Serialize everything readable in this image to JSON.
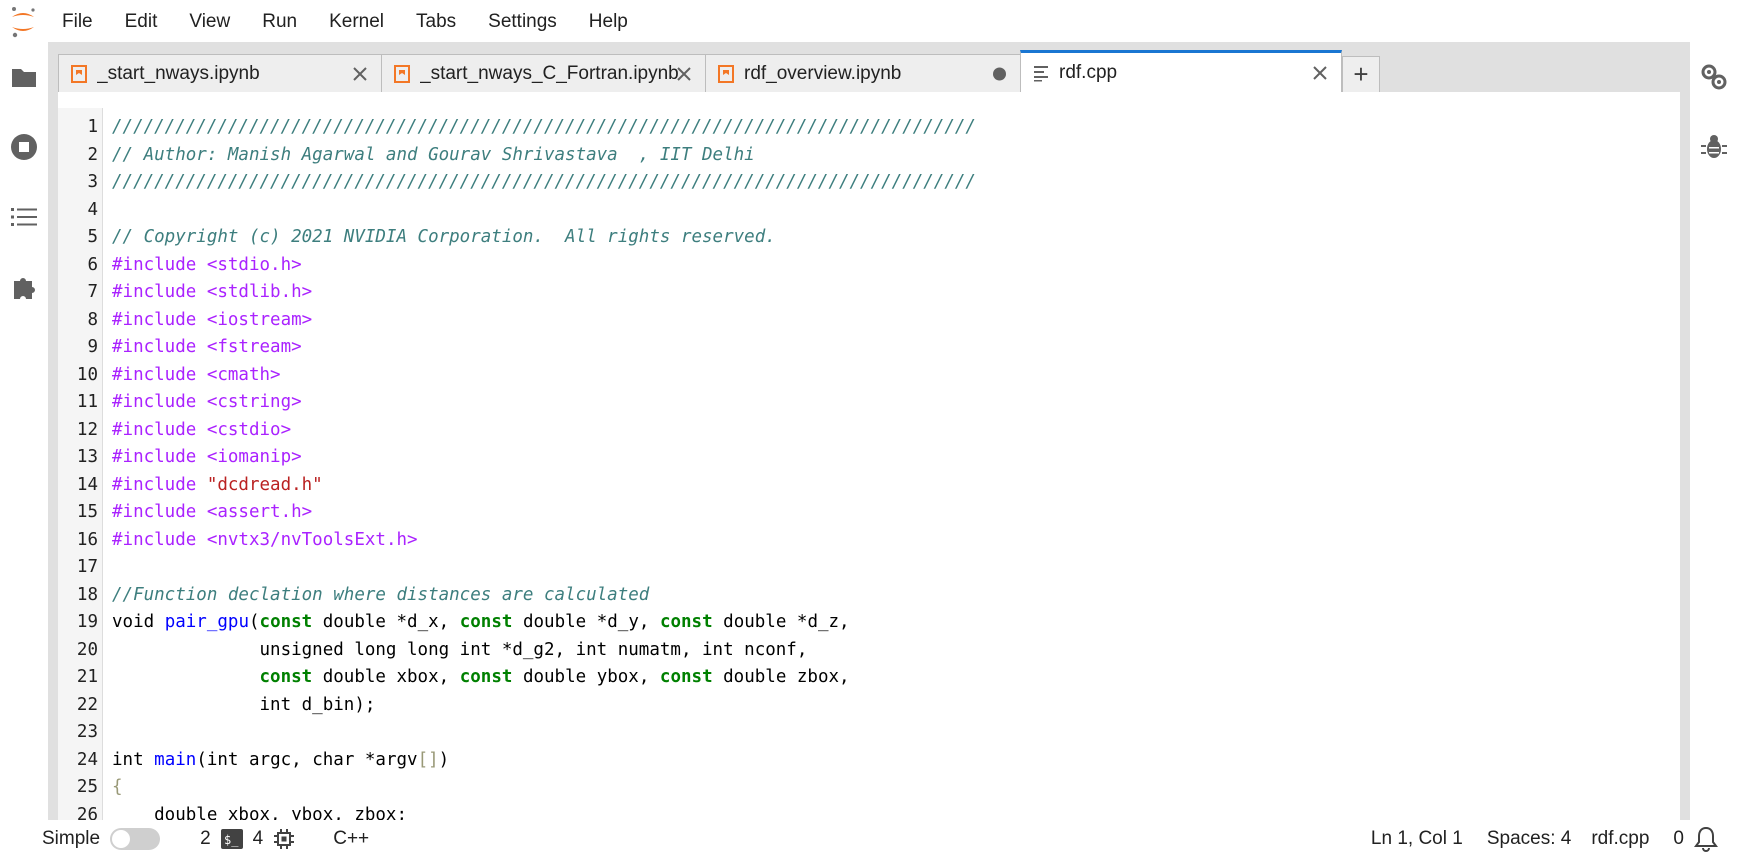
{
  "menubar": {
    "items": [
      "File",
      "Edit",
      "View",
      "Run",
      "Kernel",
      "Tabs",
      "Settings",
      "Help"
    ]
  },
  "left_sidebar": {
    "icons": [
      "folder-icon",
      "stop-circle-icon",
      "list-icon",
      "puzzle-icon"
    ]
  },
  "right_sidebar": {
    "icons": [
      "property-inspector-icon",
      "debugger-icon"
    ]
  },
  "tabs": [
    {
      "label": "_start_nways.ipynb",
      "type": "notebook",
      "state": "close"
    },
    {
      "label": "_start_nways_C_Fortran.ipynb",
      "type": "notebook",
      "state": "close"
    },
    {
      "label": "rdf_overview.ipynb",
      "type": "notebook",
      "state": "dirty"
    },
    {
      "label": "rdf.cpp",
      "type": "file",
      "state": "close",
      "active": true
    }
  ],
  "add_tab_label": "+",
  "editor": {
    "lines": [
      {
        "n": "1",
        "tokens": [
          [
            "//////////////////////////////////////////////////////////////////////////////////",
            "comment"
          ]
        ]
      },
      {
        "n": "2",
        "tokens": [
          [
            "// Author: Manish Agarwal and Gourav Shrivastava  , IIT Delhi",
            "comment"
          ]
        ]
      },
      {
        "n": "3",
        "tokens": [
          [
            "//////////////////////////////////////////////////////////////////////////////////",
            "comment"
          ]
        ]
      },
      {
        "n": "4",
        "tokens": []
      },
      {
        "n": "5",
        "tokens": [
          [
            "// Copyright (c) 2021 NVIDIA Corporation.  All rights reserved.",
            "comment"
          ]
        ]
      },
      {
        "n": "6",
        "tokens": [
          [
            "#include ",
            "keyword"
          ],
          [
            "<stdio.h>",
            "keyword"
          ]
        ]
      },
      {
        "n": "7",
        "tokens": [
          [
            "#include ",
            "keyword"
          ],
          [
            "<stdlib.h>",
            "keyword"
          ]
        ]
      },
      {
        "n": "8",
        "tokens": [
          [
            "#include ",
            "keyword"
          ],
          [
            "<iostream>",
            "keyword"
          ]
        ]
      },
      {
        "n": "9",
        "tokens": [
          [
            "#include ",
            "keyword"
          ],
          [
            "<fstream>",
            "keyword"
          ]
        ]
      },
      {
        "n": "10",
        "tokens": [
          [
            "#include ",
            "keyword"
          ],
          [
            "<cmath>",
            "keyword"
          ]
        ]
      },
      {
        "n": "11",
        "tokens": [
          [
            "#include ",
            "keyword"
          ],
          [
            "<cstring>",
            "keyword"
          ]
        ]
      },
      {
        "n": "12",
        "tokens": [
          [
            "#include ",
            "keyword"
          ],
          [
            "<cstdio>",
            "keyword"
          ]
        ]
      },
      {
        "n": "13",
        "tokens": [
          [
            "#include ",
            "keyword"
          ],
          [
            "<iomanip>",
            "keyword"
          ]
        ]
      },
      {
        "n": "14",
        "tokens": [
          [
            "#include ",
            "keyword"
          ],
          [
            "\"dcdread.h\"",
            "string"
          ]
        ]
      },
      {
        "n": "15",
        "tokens": [
          [
            "#include ",
            "keyword"
          ],
          [
            "<assert.h>",
            "keyword"
          ]
        ]
      },
      {
        "n": "16",
        "tokens": [
          [
            "#include ",
            "keyword"
          ],
          [
            "<nvtx3/nvToolsExt.h>",
            "keyword"
          ]
        ]
      },
      {
        "n": "17",
        "tokens": []
      },
      {
        "n": "18",
        "tokens": [
          [
            "//Function declation where distances are calculated",
            "comment"
          ]
        ]
      },
      {
        "n": "19",
        "tokens": [
          [
            "void ",
            "plain"
          ],
          [
            "pair_gpu",
            "func"
          ],
          [
            "(",
            "plain"
          ],
          [
            "const",
            "const"
          ],
          [
            " double *d_x, ",
            "plain"
          ],
          [
            "const",
            "const"
          ],
          [
            " double *d_y, ",
            "plain"
          ],
          [
            "const",
            "const"
          ],
          [
            " double *d_z,",
            "plain"
          ]
        ]
      },
      {
        "n": "20",
        "tokens": [
          [
            "              unsigned long long int *d_g2, int numatm, int nconf,",
            "plain"
          ]
        ]
      },
      {
        "n": "21",
        "tokens": [
          [
            "              ",
            "plain"
          ],
          [
            "const",
            "const"
          ],
          [
            " double xbox, ",
            "plain"
          ],
          [
            "const",
            "const"
          ],
          [
            " double ybox, ",
            "plain"
          ],
          [
            "const",
            "const"
          ],
          [
            " double zbox,",
            "plain"
          ]
        ]
      },
      {
        "n": "22",
        "tokens": [
          [
            "              int d_bin);",
            "plain"
          ]
        ]
      },
      {
        "n": "23",
        "tokens": []
      },
      {
        "n": "24",
        "tokens": [
          [
            "int ",
            "plain"
          ],
          [
            "main",
            "func"
          ],
          [
            "(int argc, char *argv",
            "plain"
          ],
          [
            "[]",
            "bracket"
          ],
          [
            ")",
            "plain"
          ]
        ]
      },
      {
        "n": "25",
        "tokens": [
          [
            "{",
            "bracket"
          ]
        ]
      },
      {
        "n": "26",
        "tokens": [
          [
            "    double xbox, ybox, zbox;",
            "plain"
          ]
        ]
      }
    ]
  },
  "statusbar": {
    "mode_label": "Simple",
    "terminals_count": "2",
    "kernels_count": "4",
    "language": "C++",
    "cursor": "Ln 1, Col 1",
    "spaces": "Spaces: 4",
    "filename": "rdf.cpp",
    "notifications": "0"
  },
  "colors": {
    "accent": "#1976d2",
    "comment": "#3d7e7e",
    "keyword": "#aa22ff",
    "string": "#ba2121",
    "const": "#008000",
    "func": "#0000ff"
  }
}
